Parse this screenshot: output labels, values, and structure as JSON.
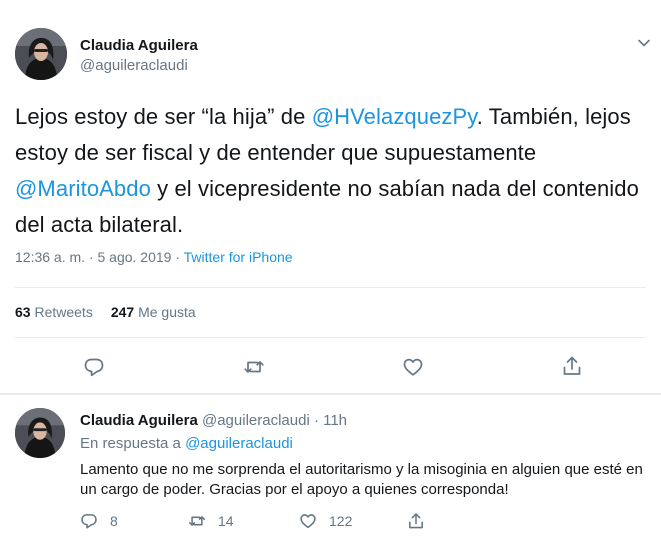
{
  "main_tweet": {
    "author_name": "Claudia Aguilera",
    "author_handle": "@aguileraclaudi",
    "text_parts": {
      "p1": "Lejos estoy de ser “la hija” de ",
      "m1": "@HVelazquezPy",
      "p2": ". También, lejos estoy de ser fiscal y de entender que supuestamente ",
      "m2": "@MaritoAbdo",
      "p3": " y el vicepresidente no sabían nada del contenido del acta bilateral."
    },
    "timestamp": "12:36 a. m. · 5 ago. 2019 · ",
    "source": "Twitter for iPhone",
    "retweets_count": "63",
    "retweets_label": " Retweets",
    "likes_count": "247",
    "likes_label": " Me gusta"
  },
  "reply_tweet": {
    "author_name": "Claudia Aguilera",
    "author_handle": "@aguileraclaudi",
    "time_ago": " · 11h",
    "in_reply_prefix": "En respuesta a ",
    "in_reply_handle": "@aguileraclaudi",
    "text": "Lamento que no me sorprenda el autoritarismo y la misoginia en alguien que esté en un cargo de poder. Gracias por el apoyo a quienes corresponda!",
    "reply_count": "8",
    "retweet_count": "14",
    "like_count": "122"
  },
  "icons": {
    "caret": "chevron-down-icon",
    "reply": "reply-icon",
    "retweet": "retweet-icon",
    "like": "heart-icon",
    "share": "share-icon"
  },
  "colors": {
    "link": "#1b95e0",
    "secondary_text": "#657786",
    "primary_text": "#14171a",
    "divider": "#e6ecf0"
  }
}
